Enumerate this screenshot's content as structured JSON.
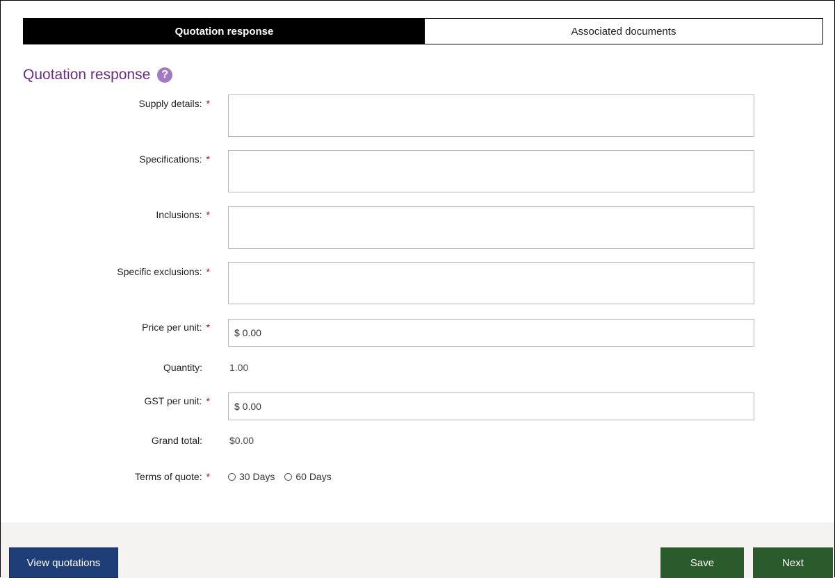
{
  "tabs": [
    {
      "label": "Quotation response",
      "active": true
    },
    {
      "label": "Associated documents",
      "active": false
    }
  ],
  "section": {
    "title": "Quotation response",
    "help_icon": "?"
  },
  "fields": {
    "supply_details": {
      "label": "Supply details:",
      "value": ""
    },
    "specifications": {
      "label": "Specifications:",
      "value": ""
    },
    "inclusions": {
      "label": "Inclusions:",
      "value": ""
    },
    "specific_exclusions": {
      "label": "Specific exclusions:",
      "value": ""
    },
    "price_per_unit": {
      "label": "Price per unit:",
      "value": "$ 0.00"
    },
    "quantity": {
      "label": "Quantity:",
      "value": "1.00"
    },
    "gst_per_unit": {
      "label": "GST per unit:",
      "value": "$ 0.00"
    },
    "grand_total": {
      "label": "Grand total:",
      "value": "$0.00"
    },
    "terms_of_quote": {
      "label": "Terms of quote:",
      "options": [
        "30 Days",
        "60 Days"
      ],
      "selected": null
    }
  },
  "required_marker": "*",
  "buttons": {
    "view_quotations": "View quotations",
    "save": "Save",
    "next": "Next"
  },
  "colors": {
    "accent_purple": "#6b2d7e",
    "required_red": "#cc0000",
    "primary_blue": "#1f3e78",
    "action_green": "#2b5a2d"
  }
}
